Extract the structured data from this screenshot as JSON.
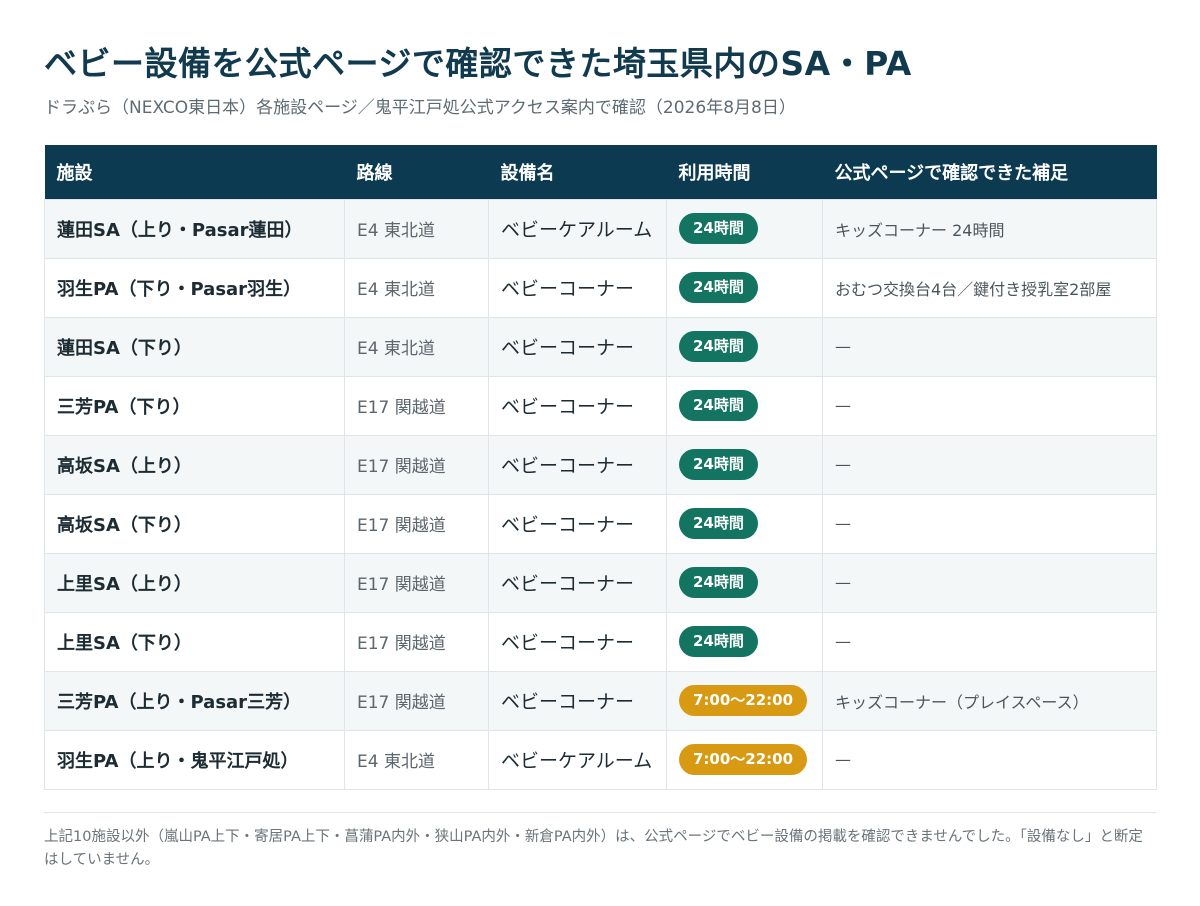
{
  "title": "ベビー設備を公式ページで確認できた埼玉県内のSA・PA",
  "subtitle": "ドラぷら（NEXCO東日本）各施設ページ／鬼平江戸処公式アクセス案内で確認（2026年8月8日）",
  "table": {
    "headers": [
      "施設",
      "路線",
      "設備名",
      "利用時間",
      "公式ページで確認できた補足"
    ],
    "rows": [
      {
        "facility": "蓮田SA（上り・Pasar蓮田）",
        "route": "E4 東北道",
        "equipment": "ベビーケアルーム",
        "hours": "24時間",
        "note": "キッズコーナー 24時間"
      },
      {
        "facility": "羽生PA（下り・Pasar羽生）",
        "route": "E4 東北道",
        "equipment": "ベビーコーナー",
        "hours": "24時間",
        "note": "おむつ交換台4台／鍵付き授乳室2部屋"
      },
      {
        "facility": "蓮田SA（下り）",
        "route": "E4 東北道",
        "equipment": "ベビーコーナー",
        "hours": "24時間",
        "note": "—"
      },
      {
        "facility": "三芳PA（下り）",
        "route": "E17 関越道",
        "equipment": "ベビーコーナー",
        "hours": "24時間",
        "note": "—"
      },
      {
        "facility": "高坂SA（上り）",
        "route": "E17 関越道",
        "equipment": "ベビーコーナー",
        "hours": "24時間",
        "note": "—"
      },
      {
        "facility": "高坂SA（下り）",
        "route": "E17 関越道",
        "equipment": "ベビーコーナー",
        "hours": "24時間",
        "note": "—"
      },
      {
        "facility": "上里SA（上り）",
        "route": "E17 関越道",
        "equipment": "ベビーコーナー",
        "hours": "24時間",
        "note": "—"
      },
      {
        "facility": "上里SA（下り）",
        "route": "E17 関越道",
        "equipment": "ベビーコーナー",
        "hours": "24時間",
        "note": "—"
      },
      {
        "facility": "三芳PA（上り・Pasar三芳）",
        "route": "E17 関越道",
        "equipment": "ベビーコーナー",
        "hours": "7:00〜22:00",
        "note": "キッズコーナー（プレイスペース）"
      },
      {
        "facility": "羽生PA（上り・鬼平江戸処）",
        "route": "E4 東北道",
        "equipment": "ベビーケアルーム",
        "hours": "7:00〜22:00",
        "note": "—"
      }
    ]
  },
  "badge_colors": {
    "24時間": "#147462",
    "7:00〜22:00": "#d89a12"
  },
  "footnote": "上記10施設以外（嵐山PA上下・寄居PA上下・菖蒲PA内外・狭山PA内外・新倉PA内外）は、公式ページでベビー設備の掲載を確認できませんでした。「設備なし」と断定はしていません。"
}
